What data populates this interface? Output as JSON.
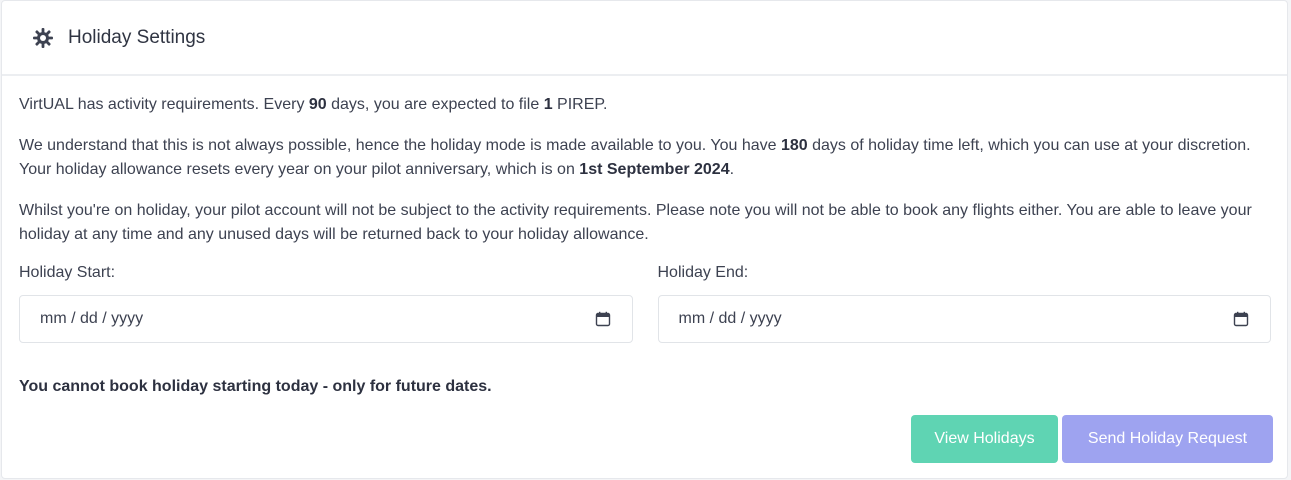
{
  "header": {
    "icon": "gear-icon",
    "title": "Holiday Settings"
  },
  "intro": {
    "part1": "VirtUAL has activity requirements. Every ",
    "days": "90",
    "part2": " days, you are expected to file ",
    "pireps": "1",
    "part3": " PIREP."
  },
  "allowance": {
    "part1": "We understand that this is not always possible, hence the holiday mode is made available to you. You have ",
    "days_left": "180",
    "part2": " days of holiday time left, which you can use at your discretion. Your holiday allowance resets every year on your pilot anniversary, which is on ",
    "anniversary": "1st September 2024",
    "part3": "."
  },
  "notice": "Whilst you're on holiday, your pilot account will not be subject to the activity requirements. Please note you will not be able to book any flights either. You are able to leave your holiday at any time and any unused days will be returned back to your holiday allowance.",
  "form": {
    "start_label": "Holiday Start:",
    "start_placeholder": "mm / dd / yyyy",
    "end_label": "Holiday End:",
    "end_placeholder": "mm / dd / yyyy",
    "calendar_icon": "calendar-icon"
  },
  "warning": "You cannot book holiday starting today - only for future dates.",
  "buttons": {
    "view": "View Holidays",
    "send": "Send Holiday Request"
  },
  "colors": {
    "view_button": "#5fd4b3",
    "send_button": "#9ea3f0",
    "text": "#3d4251"
  }
}
